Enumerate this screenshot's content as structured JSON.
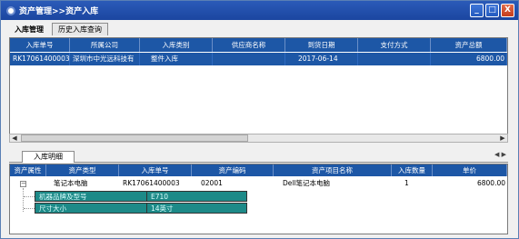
{
  "window": {
    "title": "资产管理>>资产入库",
    "controls": {
      "minimize": "_",
      "maximize": "□",
      "close": "X"
    }
  },
  "tabs": [
    {
      "label": "入库管理",
      "active": true
    },
    {
      "label": "历史入库查询",
      "active": false
    }
  ],
  "receipt_grid": {
    "columns": [
      "入库单号",
      "所属公司",
      "入库类别",
      "供应商名称",
      "到货日期",
      "支付方式",
      "资产总额"
    ],
    "rows": [
      [
        "RK17061400003",
        "深圳市中光远科技有",
        "整件入库",
        "",
        "2017-06-14",
        "",
        "6800.00"
      ]
    ]
  },
  "detail_tab": {
    "label": "入库明细"
  },
  "detail_grid": {
    "columns": [
      "资产属性",
      "资产类型",
      "入库单号",
      "资产编码",
      "资产项目名称",
      "入库数量",
      "单价"
    ],
    "rows": [
      [
        "",
        "笔记本电脑",
        "RK17061400003",
        "02001",
        "Dell笔记本电脑",
        "1",
        "6800.00"
      ]
    ],
    "properties": [
      {
        "key": "机器品牌及型号",
        "value": "E710"
      },
      {
        "key": "尺寸大小",
        "value": "14英寸"
      }
    ]
  },
  "colors": {
    "header_bg": "#1d57a6",
    "prop_bg": "#1d8a88",
    "titlebar": "#2b5bb8"
  }
}
